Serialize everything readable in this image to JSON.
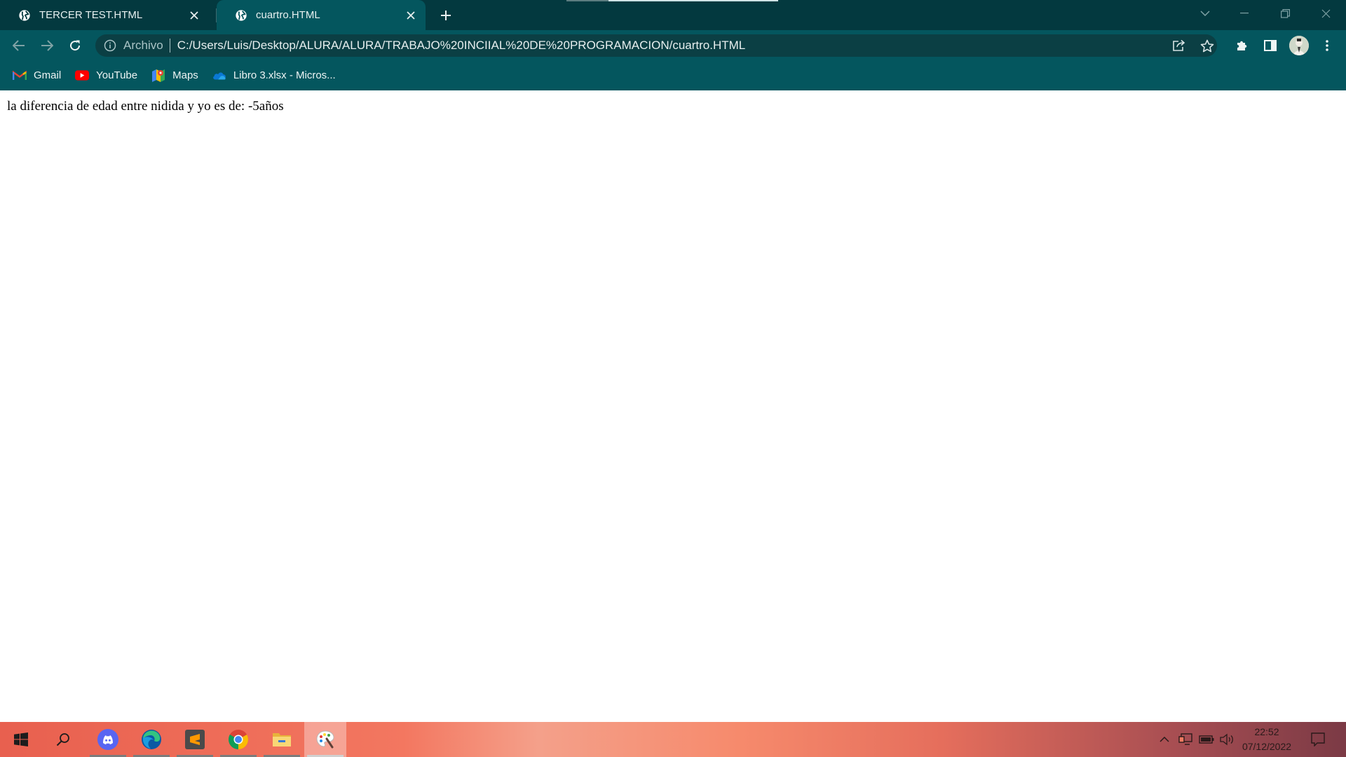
{
  "browser": {
    "tabs": [
      {
        "title": "TERCER TEST.HTML",
        "active": false
      },
      {
        "title": "cuartro.HTML",
        "active": true
      }
    ],
    "address_bar": {
      "scheme_label": "Archivo",
      "url": "C:/Users/Luis/Desktop/ALURA/ALURA/TRABAJO%20INCIIAL%20DE%20PROGRAMACION/cuartro.HTML"
    },
    "bookmarks": [
      {
        "label": "Gmail",
        "icon": "gmail-icon"
      },
      {
        "label": "YouTube",
        "icon": "youtube-icon"
      },
      {
        "label": "Maps",
        "icon": "maps-icon"
      },
      {
        "label": "Libro 3.xlsx - Micros...",
        "icon": "onedrive-icon"
      }
    ],
    "colors": {
      "tabstrip": "#03393f",
      "toolbar": "#04565e",
      "omnibox": "#0b3f44"
    }
  },
  "page": {
    "text": "la diferencia de edad entre nidida y yo es de: -5años"
  },
  "taskbar": {
    "apps": [
      "start-icon",
      "search-icon",
      "discord-icon",
      "edge-icon",
      "sublime-text-icon",
      "chrome-icon",
      "file-explorer-icon",
      "paint-icon"
    ],
    "clock": {
      "time": "22:52",
      "date": "07/12/2022"
    }
  }
}
